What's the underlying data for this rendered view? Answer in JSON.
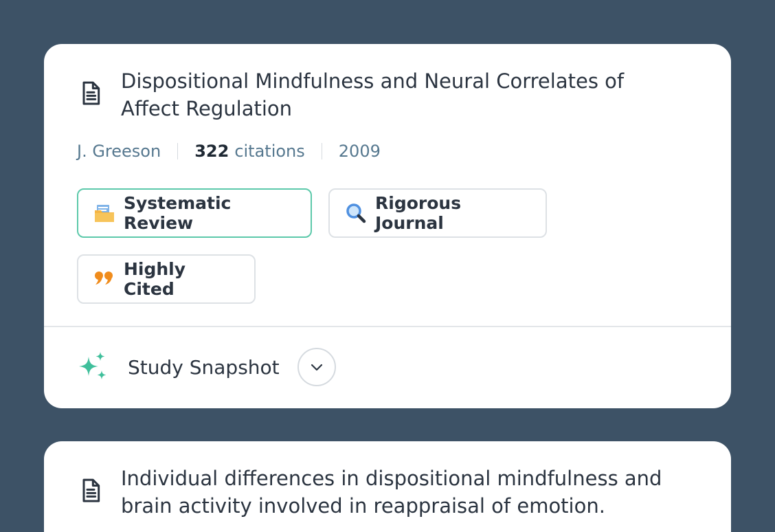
{
  "papers": [
    {
      "title": "Dispositional Mindfulness and Neural Correlates of Affect Regulation",
      "author": "J. Greeson",
      "citation_count": "322",
      "citation_label": "citations",
      "year": "2009",
      "badges": [
        {
          "label": "Systematic Review",
          "icon": "folder-icon"
        },
        {
          "label": "Rigorous Journal",
          "icon": "magnifier-icon"
        },
        {
          "label": "Highly Cited",
          "icon": "quote-icon"
        }
      ],
      "snapshot_label": "Study Snapshot"
    },
    {
      "title": "Individual differences in dispositional mindfulness and brain activity involved in reappraisal of emotion."
    }
  ],
  "colors": {
    "background": "#3d5266",
    "accent": "#3fbf9b",
    "meta_text": "#56788f",
    "quote": "#f08c1c"
  }
}
